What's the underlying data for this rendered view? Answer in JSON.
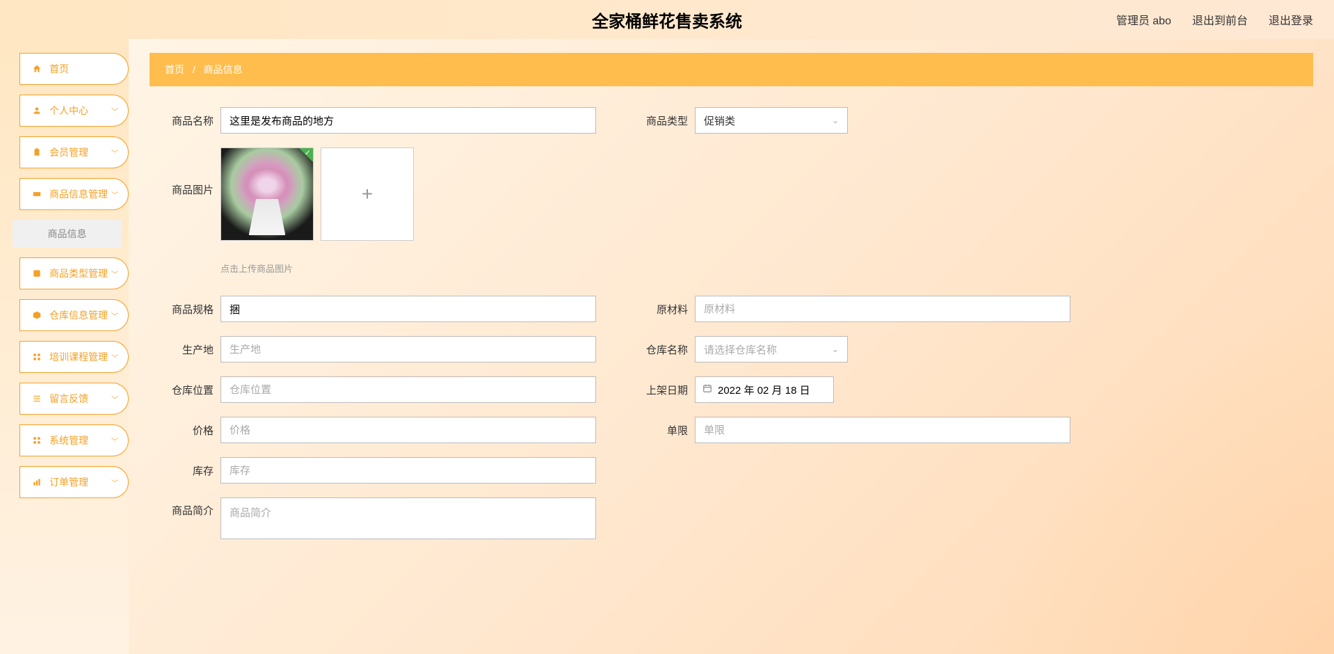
{
  "header": {
    "title": "全家桶鲜花售卖系统",
    "admin_label": "管理员 abo",
    "front_link": "退出到前台",
    "logout": "退出登录"
  },
  "sidebar": {
    "home": "首页",
    "personal": "个人中心",
    "member_mgmt": "会员管理",
    "product_info_mgmt": "商品信息管理",
    "product_info": "商品信息",
    "product_type_mgmt": "商品类型管理",
    "warehouse_mgmt": "仓库信息管理",
    "training_mgmt": "培训课程管理",
    "feedback": "留言反馈",
    "system_mgmt": "系统管理",
    "order_mgmt": "订单管理"
  },
  "breadcrumb": {
    "home": "首页",
    "sep": "/",
    "current": "商品信息"
  },
  "form": {
    "product_name": {
      "label": "商品名称",
      "value": "这里是发布商品的地方"
    },
    "product_type": {
      "label": "商品类型",
      "value": "促销类"
    },
    "product_image": {
      "label": "商品图片",
      "hint": "点击上传商品图片"
    },
    "spec": {
      "label": "商品规格",
      "value": "捆"
    },
    "material": {
      "label": "原材料",
      "placeholder": "原材料"
    },
    "origin": {
      "label": "生产地",
      "placeholder": "生产地"
    },
    "warehouse_name": {
      "label": "仓库名称",
      "placeholder": "请选择仓库名称"
    },
    "warehouse_loc": {
      "label": "仓库位置",
      "placeholder": "仓库位置"
    },
    "list_date": {
      "label": "上架日期",
      "value": "2022 年 02 月 18 日"
    },
    "price": {
      "label": "价格",
      "placeholder": "价格"
    },
    "single_limit": {
      "label": "单限",
      "placeholder": "单限"
    },
    "stock": {
      "label": "库存",
      "placeholder": "库存"
    },
    "summary": {
      "label": "商品简介",
      "placeholder": "商品简介"
    }
  }
}
